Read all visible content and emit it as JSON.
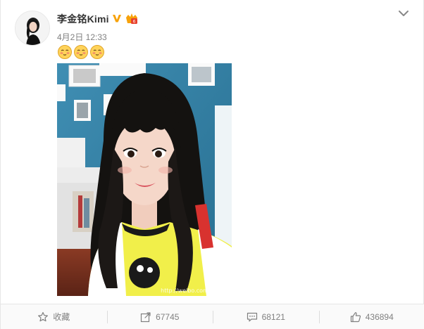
{
  "post": {
    "author": "李金铭Kimi",
    "time": "4月2日 12:33",
    "emojis": [
      "shy-face-icon",
      "shy-face-icon",
      "shy-face-icon"
    ],
    "image_watermark": "http://weibo.com/kimi..."
  },
  "actions": {
    "favorite_label": "收藏",
    "repost_count": "67745",
    "comment_count": "68121",
    "like_count": "436894"
  },
  "colors": {
    "accent_orange": "#f7a20a",
    "text_muted": "#808080",
    "wall_blue": "#2f80a6"
  }
}
